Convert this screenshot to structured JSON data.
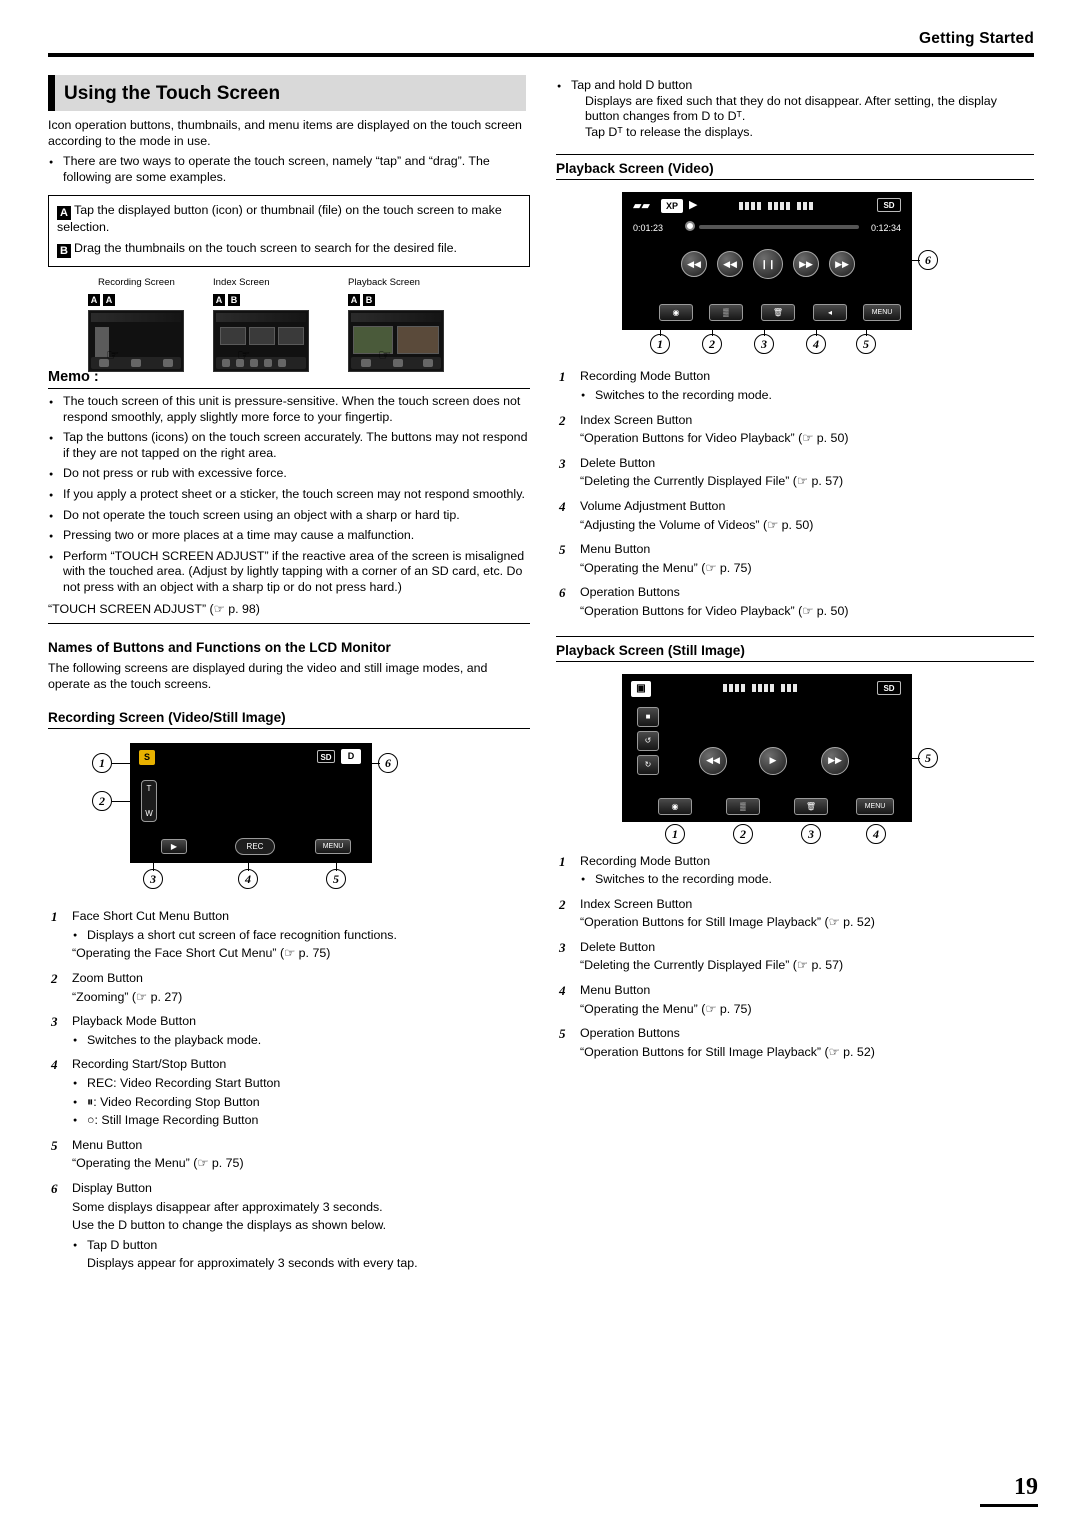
{
  "header": {
    "section_title": "Getting Started"
  },
  "chapter": {
    "title": "Using the Touch Screen"
  },
  "left": {
    "intro": "Icon operation buttons, thumbnails, and menu items are displayed on the touch screen according to the mode in use.",
    "intro_bullets": [
      "There are two ways to operate the touch screen, namely “tap” and “drag”. The following are some examples."
    ],
    "box": {
      "a_tag": "A",
      "a_text": "Tap the displayed button (icon) or thumbnail (file) on the touch screen to make selection.",
      "b_tag": "B",
      "b_text": "Drag the thumbnails on the touch screen to search for the desired file."
    },
    "thumbs": [
      {
        "caption": "Recording Screen",
        "tags": [
          "A",
          "A"
        ]
      },
      {
        "caption": "Index Screen",
        "tags": [
          "A",
          "B"
        ]
      },
      {
        "caption": "Playback Screen",
        "tags": [
          "A",
          "B"
        ]
      }
    ],
    "memo_title": "Memo :",
    "memo_bullets": [
      "The touch screen of this unit is pressure-sensitive. When the touch screen does not respond smoothly, apply slightly more force to your fingertip.",
      "Tap the buttons (icons) on the touch screen accurately. The buttons may not respond if they are not tapped on the right area.",
      "Do not press or rub with excessive force.",
      "If you apply a protect sheet or a sticker, the touch screen may not respond smoothly.",
      "Do not operate the touch screen using an object with a sharp or hard tip.",
      "Pressing two or more places at a time may cause a malfunction.",
      "Perform “TOUCH SCREEN ADJUST” if the reactive area of the screen is misaligned with the touched area. (Adjust by lightly tapping with a corner of an SD card, etc. Do not press with an object with a sharp tip or do not press hard.)"
    ],
    "memo_ref": "“TOUCH SCREEN ADJUST” (☞ p. 98)",
    "names_heading": "Names of Buttons and Functions on the LCD Monitor",
    "names_text": "The following screens are displayed during the video and still image modes, and operate as the touch screens.",
    "rec_heading": "Recording Screen (Video/Still Image)",
    "rec_screen": {
      "mode_icon": "S",
      "sd_tag": "SD",
      "d_tag": "D",
      "zoom_top": "T",
      "zoom_bottom": "W",
      "playback_btn": "▶",
      "rec_btn": "REC",
      "menu_btn": "MENU",
      "callouts": [
        "1",
        "2",
        "3",
        "4",
        "5",
        "6"
      ]
    },
    "rec_items": [
      {
        "n": "1",
        "title": "Face Short Cut Menu Button",
        "bullets": [
          "Displays a short cut screen of face recognition functions."
        ],
        "refs": [
          "“Operating the Face Short Cut Menu” (☞ p. 75)"
        ]
      },
      {
        "n": "2",
        "title": "Zoom Button",
        "bullets": [],
        "refs": [
          "“Zooming” (☞ p. 27)"
        ]
      },
      {
        "n": "3",
        "title": "Playback Mode Button",
        "bullets": [
          "Switches to the playback mode."
        ],
        "refs": []
      },
      {
        "n": "4",
        "title": "Recording Start/Stop Button",
        "bullets": [
          "REC: Video Recording Start Button",
          "⏸: Video Recording Stop Button",
          "○: Still Image Recording Button"
        ],
        "refs": []
      },
      {
        "n": "5",
        "title": "Menu Button",
        "bullets": [],
        "refs": [
          "“Operating the Menu” (☞ p. 75)"
        ]
      },
      {
        "n": "6",
        "title": "Display Button",
        "bullets": [],
        "refs": [
          "Some displays disappear after approximately 3 seconds.",
          "Use the D button to change the displays as shown below."
        ],
        "sub_bullets": [
          {
            "label": "Tap D button",
            "text": "Displays appear for approximately 3 seconds with every tap."
          }
        ]
      }
    ]
  },
  "right": {
    "top_bullet": {
      "label": "Tap and hold D button",
      "lines": [
        "Displays are fixed such that they do not disappear. After setting, the display button changes from D to Dᵀ.",
        "Tap Dᵀ to release the displays."
      ]
    },
    "video_heading": "Playback Screen (Video)",
    "video_screen": {
      "icons": {
        "camera": "🎥",
        "quality": "XP",
        "play": "▶",
        "sd": "SD"
      },
      "time_current": "0:01:23",
      "time_total": "0:12:34",
      "ops": [
        "◀◀",
        "◀◀",
        "❙❙",
        "▶▶",
        "▶▶"
      ],
      "bottom": [
        "◉",
        "▒",
        "🗑",
        "◂",
        "MENU"
      ],
      "callouts": [
        "1",
        "2",
        "3",
        "4",
        "5",
        "6"
      ]
    },
    "video_items": [
      {
        "n": "1",
        "title": "Recording Mode Button",
        "bullets": [
          "Switches to the recording mode."
        ],
        "refs": []
      },
      {
        "n": "2",
        "title": "Index Screen Button",
        "bullets": [],
        "refs": [
          "“Operation Buttons for Video Playback” (☞ p. 50)"
        ]
      },
      {
        "n": "3",
        "title": "Delete Button",
        "bullets": [],
        "refs": [
          "“Deleting the Currently Displayed File” (☞ p. 57)"
        ]
      },
      {
        "n": "4",
        "title": "Volume Adjustment Button",
        "bullets": [],
        "refs": [
          "“Adjusting the Volume of Videos” (☞ p. 50)"
        ]
      },
      {
        "n": "5",
        "title": "Menu Button",
        "bullets": [],
        "refs": [
          "“Operating the Menu” (☞ p. 75)"
        ]
      },
      {
        "n": "6",
        "title": "Operation Buttons",
        "bullets": [],
        "refs": [
          "“Operation Buttons for Video Playback” (☞ p. 50)"
        ]
      }
    ],
    "still_heading": "Playback Screen (Still Image)",
    "still_screen": {
      "icons": {
        "camera": "📷",
        "sd": "SD"
      },
      "ops": [
        "◀◀",
        "▶",
        "▶▶"
      ],
      "side": [
        "■",
        "↺",
        "↻"
      ],
      "bottom": [
        "◉",
        "▒",
        "🗑",
        "MENU"
      ],
      "callouts": [
        "1",
        "2",
        "3",
        "4",
        "5"
      ]
    },
    "still_items": [
      {
        "n": "1",
        "title": "Recording Mode Button",
        "bullets": [
          "Switches to the recording mode."
        ],
        "refs": []
      },
      {
        "n": "2",
        "title": "Index Screen Button",
        "bullets": [],
        "refs": [
          "“Operation Buttons for Still Image Playback” (☞ p. 52)"
        ]
      },
      {
        "n": "3",
        "title": "Delete Button",
        "bullets": [],
        "refs": [
          "“Deleting the Currently Displayed File” (☞ p. 57)"
        ]
      },
      {
        "n": "4",
        "title": "Menu Button",
        "bullets": [],
        "refs": [
          "“Operating the Menu” (☞ p. 75)"
        ]
      },
      {
        "n": "5",
        "title": "Operation Buttons",
        "bullets": [],
        "refs": [
          "“Operation Buttons for Still Image Playback” (☞ p. 52)"
        ]
      }
    ]
  },
  "footer": {
    "page_number": "19"
  }
}
